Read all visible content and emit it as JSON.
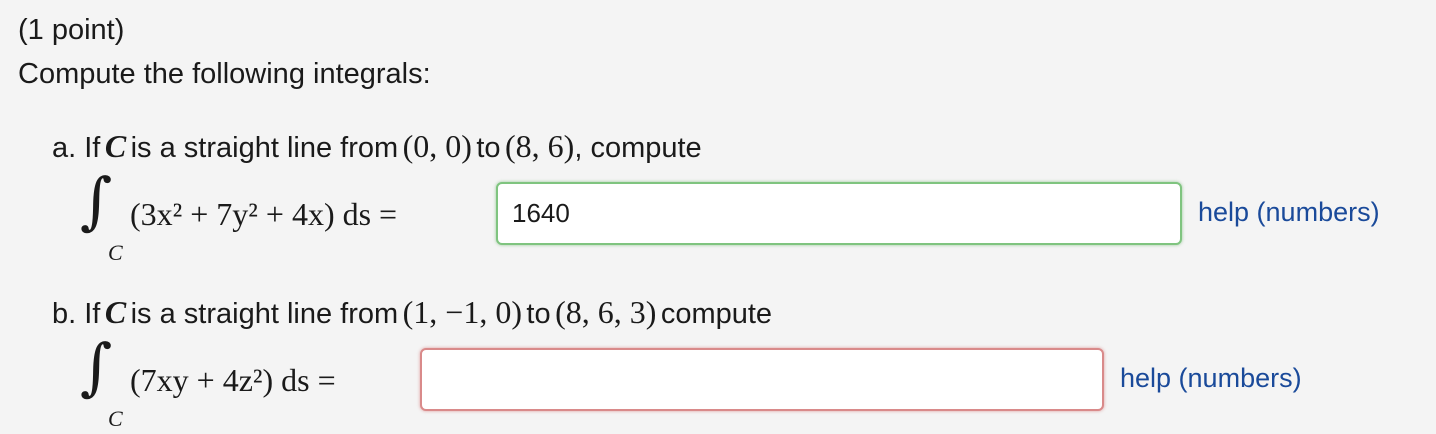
{
  "header": {
    "points": "(1 point)",
    "instructions": "Compute the following integrals:"
  },
  "part_a": {
    "label_prefix": "a. If",
    "curve": "C",
    "text_1": "is a straight line from",
    "start_point": "(0, 0)",
    "text_2": "to",
    "end_point": "(8, 6)",
    "text_3": ", compute",
    "integral_sign": "∫",
    "subscript": "C",
    "integrand": "(3x² + 7y² + 4x) ds =",
    "answer_value": "1640",
    "help_label": "help (numbers)",
    "status_color": "#7fc47f"
  },
  "part_b": {
    "label_prefix": "b. If",
    "curve": "C",
    "text_1": "is a straight line from",
    "start_point": "(1, −1, 0)",
    "text_2": "to",
    "end_point": "(8, 6, 3)",
    "text_3": "compute",
    "integral_sign": "∫",
    "subscript": "C",
    "integrand": "(7xy + 4z²) ds =",
    "answer_value": "",
    "help_label": "help (numbers)",
    "status_color": "#d98a8a"
  }
}
